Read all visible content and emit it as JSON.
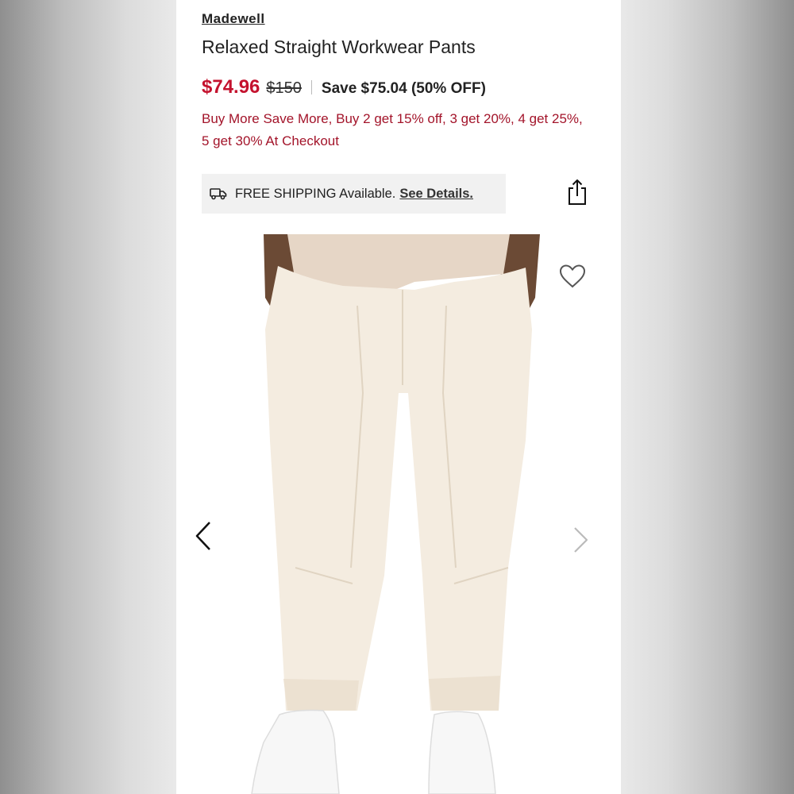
{
  "product": {
    "brand": "Madewell",
    "title": "Relaxed Straight Workwear Pants",
    "sale_price": "$74.96",
    "original_price": "$150",
    "savings": "Save $75.04 (50% OFF)",
    "promo": "Buy More Save More, Buy 2 get 15% off, 3 get 20%, 4 get 25%, 5 get 30% At Checkout"
  },
  "shipping": {
    "text": "FREE SHIPPING Available.",
    "link": "See Details."
  },
  "icons": {
    "truck": "truck-icon",
    "share": "share-icon",
    "heart": "heart-icon",
    "prev": "chevron-left-icon",
    "next": "chevron-right-icon"
  },
  "colors": {
    "sale": "#c4122e",
    "promo": "#a3142a",
    "pants": "#f4ece0",
    "shoes": "#f7f7f7"
  }
}
